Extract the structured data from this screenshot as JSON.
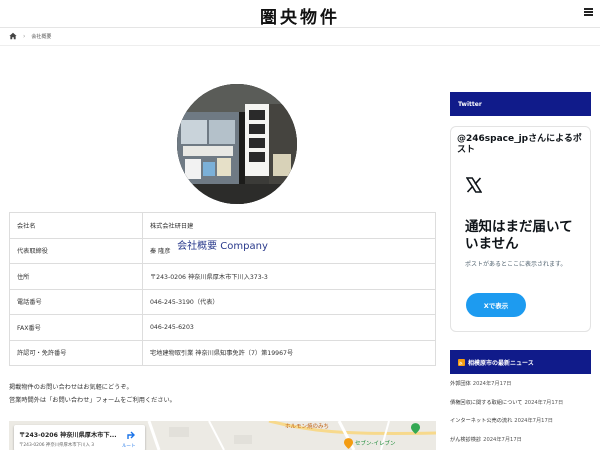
{
  "header": {
    "site_title": "圏央物件",
    "menu_icon": "hamburger-icon"
  },
  "breadcrumb": {
    "home_icon": "home-icon",
    "current": "会社概要"
  },
  "profile": {
    "title": "会社概要 Company"
  },
  "company_table": [
    {
      "label": "会社名",
      "value": "株式会社研日建"
    },
    {
      "label": "代表取締役",
      "value": "秦 隆彦"
    },
    {
      "label": "住所",
      "value": "〒243-0206 神奈川県厚木市下川入373-3"
    },
    {
      "label": "電話番号",
      "value": "046-245-3190（代表）"
    },
    {
      "label": "FAX番号",
      "value": "046-245-6203"
    },
    {
      "label": "許認可・免許番号",
      "value": "宅地建物取引業 神奈川県知事免許（7）第19967号"
    }
  ],
  "contact": {
    "line1": "掲載物件のお問い合わせはお気軽にどうぞ。",
    "line2": "営業時間外は「お問い合わせ」フォームをご利用ください。"
  },
  "map": {
    "card_title": "〒243-0206 神奈川県厚木市下...",
    "card_address": "〒243-0206 神奈川県厚木市下川入 3",
    "route_label": "ルート",
    "place_label_1": "ホルモン焼のみち",
    "place_label_2": "セブン-イレブン"
  },
  "sidebar": {
    "twitter_heading": "Twitter",
    "twitter_embed": {
      "title": "@246space_jpさんによるポスト",
      "message": "通知はまだ届いていません",
      "sub": "ポストがあるとここに表示されます。",
      "button": "Xで表示"
    },
    "news_heading": "相模原市の最新ニュース",
    "news": [
      {
        "title": "外郭団体",
        "date": "2024年7月17日"
      },
      {
        "title": "債権回収に関する取組について",
        "date": "2024年7月17日"
      },
      {
        "title": "インターネット公売の流れ",
        "date": "2024年7月17日"
      },
      {
        "title": "がん検診検診",
        "date": "2024年7月17日"
      }
    ]
  },
  "colors": {
    "accent_navy": "#101b8a",
    "link_blue": "#2a3a8c",
    "x_button": "#1d9bf0"
  }
}
